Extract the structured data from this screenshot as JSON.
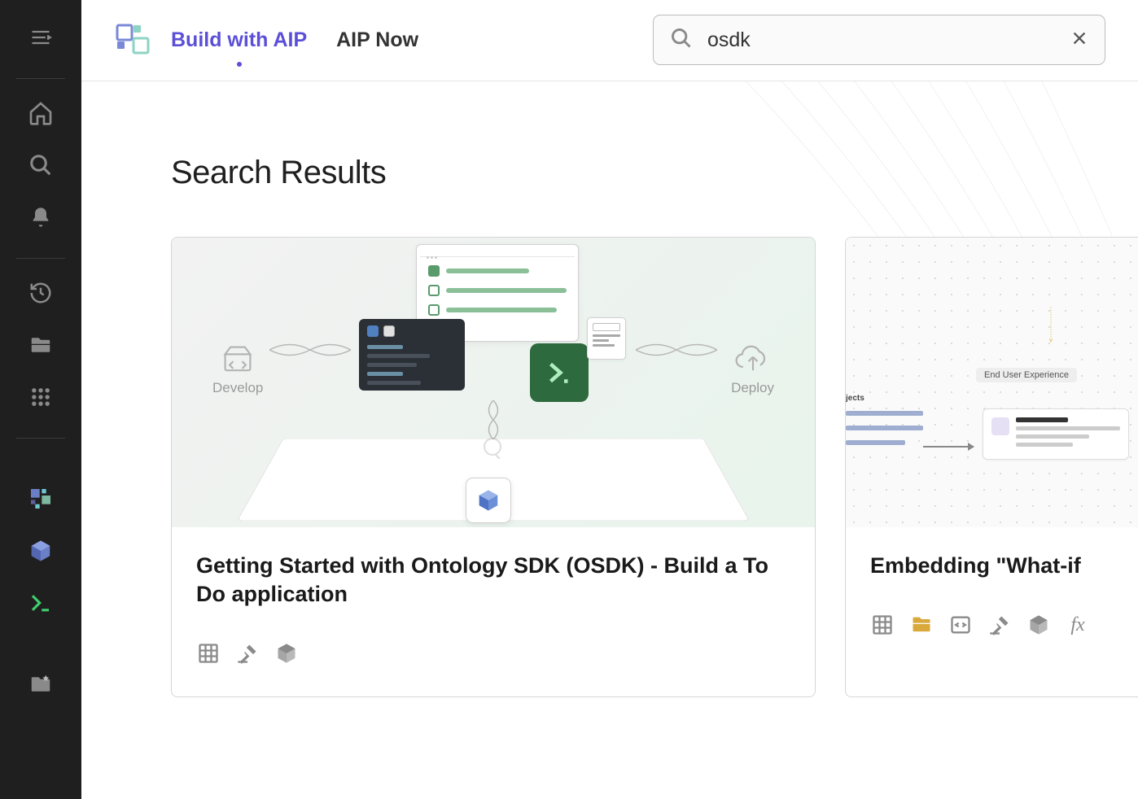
{
  "sidebar": {
    "icons": {
      "menu": "menu-icon",
      "home": "home-icon",
      "search": "search-icon",
      "bell": "bell-icon",
      "history": "history-icon",
      "folder": "folder-icon",
      "apps": "apps-icon",
      "pixel": "pixel-app-icon",
      "cube": "cube-icon",
      "terminal": "terminal-icon",
      "starfolder": "star-folder-icon"
    }
  },
  "header": {
    "tab_active": "Build with AIP",
    "tab_secondary": "AIP Now",
    "search_value": "osdk"
  },
  "page": {
    "title": "Search Results"
  },
  "cards": [
    {
      "title": "Getting Started with Ontology SDK (OSDK) - Build a To Do application",
      "hero": {
        "left_label": "Develop",
        "right_label": "Deploy"
      },
      "tags": [
        "grid-icon",
        "gavel-icon",
        "cube-icon"
      ]
    },
    {
      "title": "Embedding \"What-if",
      "hero": {
        "pill_label": "End User Experience"
      },
      "tags": [
        "grid-icon",
        "folder-icon",
        "code-icon",
        "gavel-icon",
        "cube-icon",
        "function-icon"
      ]
    }
  ]
}
